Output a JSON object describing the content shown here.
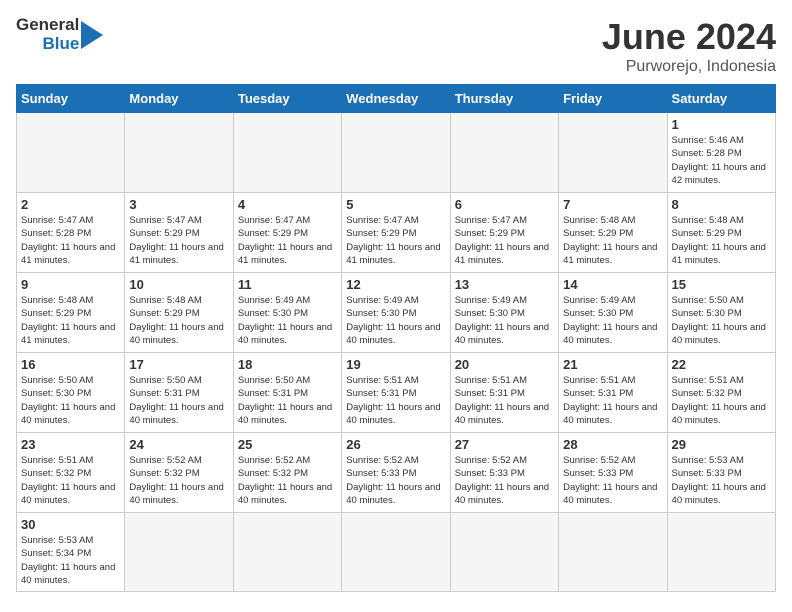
{
  "header": {
    "logo_general": "General",
    "logo_blue": "Blue",
    "title": "June 2024",
    "location": "Purworejo, Indonesia"
  },
  "days_of_week": [
    "Sunday",
    "Monday",
    "Tuesday",
    "Wednesday",
    "Thursday",
    "Friday",
    "Saturday"
  ],
  "weeks": [
    [
      {
        "day": "",
        "info": ""
      },
      {
        "day": "",
        "info": ""
      },
      {
        "day": "",
        "info": ""
      },
      {
        "day": "",
        "info": ""
      },
      {
        "day": "",
        "info": ""
      },
      {
        "day": "",
        "info": ""
      },
      {
        "day": "1",
        "info": "Sunrise: 5:46 AM\nSunset: 5:28 PM\nDaylight: 11 hours\nand 42 minutes."
      }
    ],
    [
      {
        "day": "2",
        "info": "Sunrise: 5:47 AM\nSunset: 5:28 PM\nDaylight: 11 hours\nand 41 minutes."
      },
      {
        "day": "3",
        "info": "Sunrise: 5:47 AM\nSunset: 5:29 PM\nDaylight: 11 hours\nand 41 minutes."
      },
      {
        "day": "4",
        "info": "Sunrise: 5:47 AM\nSunset: 5:29 PM\nDaylight: 11 hours\nand 41 minutes."
      },
      {
        "day": "5",
        "info": "Sunrise: 5:47 AM\nSunset: 5:29 PM\nDaylight: 11 hours\nand 41 minutes."
      },
      {
        "day": "6",
        "info": "Sunrise: 5:47 AM\nSunset: 5:29 PM\nDaylight: 11 hours\nand 41 minutes."
      },
      {
        "day": "7",
        "info": "Sunrise: 5:48 AM\nSunset: 5:29 PM\nDaylight: 11 hours\nand 41 minutes."
      },
      {
        "day": "8",
        "info": "Sunrise: 5:48 AM\nSunset: 5:29 PM\nDaylight: 11 hours\nand 41 minutes."
      }
    ],
    [
      {
        "day": "9",
        "info": "Sunrise: 5:48 AM\nSunset: 5:29 PM\nDaylight: 11 hours\nand 41 minutes."
      },
      {
        "day": "10",
        "info": "Sunrise: 5:48 AM\nSunset: 5:29 PM\nDaylight: 11 hours\nand 40 minutes."
      },
      {
        "day": "11",
        "info": "Sunrise: 5:49 AM\nSunset: 5:30 PM\nDaylight: 11 hours\nand 40 minutes."
      },
      {
        "day": "12",
        "info": "Sunrise: 5:49 AM\nSunset: 5:30 PM\nDaylight: 11 hours\nand 40 minutes."
      },
      {
        "day": "13",
        "info": "Sunrise: 5:49 AM\nSunset: 5:30 PM\nDaylight: 11 hours\nand 40 minutes."
      },
      {
        "day": "14",
        "info": "Sunrise: 5:49 AM\nSunset: 5:30 PM\nDaylight: 11 hours\nand 40 minutes."
      },
      {
        "day": "15",
        "info": "Sunrise: 5:50 AM\nSunset: 5:30 PM\nDaylight: 11 hours\nand 40 minutes."
      }
    ],
    [
      {
        "day": "16",
        "info": "Sunrise: 5:50 AM\nSunset: 5:30 PM\nDaylight: 11 hours\nand 40 minutes."
      },
      {
        "day": "17",
        "info": "Sunrise: 5:50 AM\nSunset: 5:31 PM\nDaylight: 11 hours\nand 40 minutes."
      },
      {
        "day": "18",
        "info": "Sunrise: 5:50 AM\nSunset: 5:31 PM\nDaylight: 11 hours\nand 40 minutes."
      },
      {
        "day": "19",
        "info": "Sunrise: 5:51 AM\nSunset: 5:31 PM\nDaylight: 11 hours\nand 40 minutes."
      },
      {
        "day": "20",
        "info": "Sunrise: 5:51 AM\nSunset: 5:31 PM\nDaylight: 11 hours\nand 40 minutes."
      },
      {
        "day": "21",
        "info": "Sunrise: 5:51 AM\nSunset: 5:31 PM\nDaylight: 11 hours\nand 40 minutes."
      },
      {
        "day": "22",
        "info": "Sunrise: 5:51 AM\nSunset: 5:32 PM\nDaylight: 11 hours\nand 40 minutes."
      }
    ],
    [
      {
        "day": "23",
        "info": "Sunrise: 5:51 AM\nSunset: 5:32 PM\nDaylight: 11 hours\nand 40 minutes."
      },
      {
        "day": "24",
        "info": "Sunrise: 5:52 AM\nSunset: 5:32 PM\nDaylight: 11 hours\nand 40 minutes."
      },
      {
        "day": "25",
        "info": "Sunrise: 5:52 AM\nSunset: 5:32 PM\nDaylight: 11 hours\nand 40 minutes."
      },
      {
        "day": "26",
        "info": "Sunrise: 5:52 AM\nSunset: 5:33 PM\nDaylight: 11 hours\nand 40 minutes."
      },
      {
        "day": "27",
        "info": "Sunrise: 5:52 AM\nSunset: 5:33 PM\nDaylight: 11 hours\nand 40 minutes."
      },
      {
        "day": "28",
        "info": "Sunrise: 5:52 AM\nSunset: 5:33 PM\nDaylight: 11 hours\nand 40 minutes."
      },
      {
        "day": "29",
        "info": "Sunrise: 5:53 AM\nSunset: 5:33 PM\nDaylight: 11 hours\nand 40 minutes."
      }
    ],
    [
      {
        "day": "30",
        "info": "Sunrise: 5:53 AM\nSunset: 5:34 PM\nDaylight: 11 hours\nand 40 minutes."
      },
      {
        "day": "",
        "info": ""
      },
      {
        "day": "",
        "info": ""
      },
      {
        "day": "",
        "info": ""
      },
      {
        "day": "",
        "info": ""
      },
      {
        "day": "",
        "info": ""
      },
      {
        "day": "",
        "info": ""
      }
    ]
  ]
}
